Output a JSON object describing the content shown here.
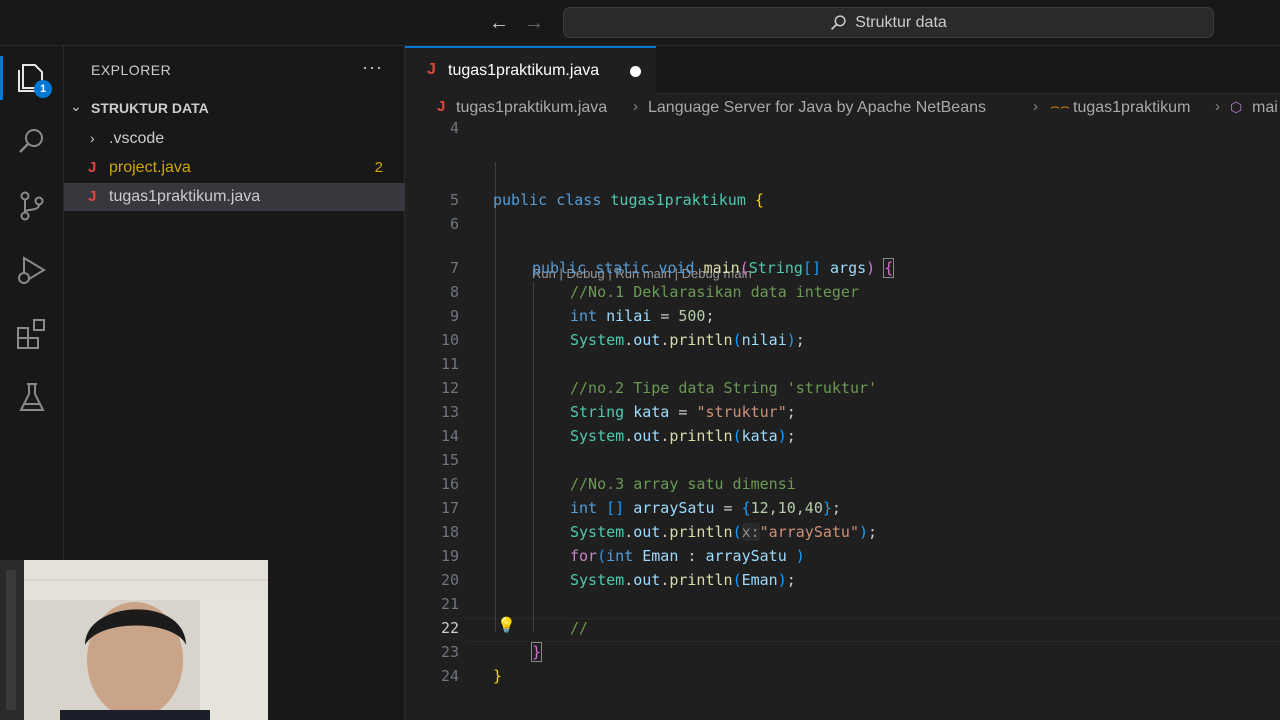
{
  "titlebar": {
    "search_text": "Struktur data"
  },
  "activitybar": {
    "explorer_badge": "1"
  },
  "sidebar": {
    "title": "EXPLORER",
    "more": "···",
    "folder_name": "STRUKTUR DATA",
    "items": [
      {
        "label": ".vscode",
        "icon": "chevron-right"
      },
      {
        "label": "project.java",
        "icon": "java-icon",
        "problems": "2"
      },
      {
        "label": "tugas1praktikum.java",
        "icon": "java-icon"
      }
    ]
  },
  "editor": {
    "tab_label": "tugas1praktikum.java",
    "breadcrumb": [
      "tugas1praktikum.java",
      "Language Server for Java by Apache NetBeans",
      "tugas1praktikum",
      "mai"
    ],
    "codelens": "Run | Debug | Run main | Debug main",
    "line_numbers": [
      "4",
      "5",
      "6",
      "7",
      "8",
      "9",
      "10",
      "11",
      "12",
      "13",
      "14",
      "15",
      "16",
      "17",
      "18",
      "19",
      "20",
      "21",
      "22",
      "23",
      "24"
    ],
    "active_line": "22",
    "lines": {
      "l5": [
        "public",
        "class",
        "tugas1praktikum",
        "{"
      ],
      "l7": [
        "public",
        "static",
        "void",
        "main",
        "(",
        "String",
        "[]",
        "args",
        ")",
        "{"
      ],
      "l8": "//No.1 Deklarasikan data integer",
      "l9": [
        "int",
        "nilai",
        "=",
        "500",
        ";"
      ],
      "l10": [
        "System",
        ".",
        "out",
        ".",
        "println",
        "(",
        "nilai",
        ")",
        ";"
      ],
      "l12": "//no.2 Tipe data String 'struktur'",
      "l13": [
        "String",
        "kata",
        "=",
        "\"struktur\"",
        ";"
      ],
      "l14": [
        "System",
        ".",
        "out",
        ".",
        "println",
        "(",
        "kata",
        ")",
        ";"
      ],
      "l16": "//No.3 array satu dimensi",
      "l17": [
        "int",
        "[]",
        "arraySatu",
        "=",
        "{",
        "12,10,40",
        "}",
        ";"
      ],
      "l18": [
        "System",
        ".",
        "out",
        ".",
        "println",
        "(",
        "x:",
        "\"arraySatu\"",
        ")",
        ";"
      ],
      "l19": [
        "for",
        "(",
        "int",
        "Eman",
        ":",
        "arraySatu",
        ")"
      ],
      "l20": [
        "System",
        ".",
        "out",
        ".",
        "println",
        "(",
        "Eman",
        ")",
        ";"
      ],
      "l22": "//",
      "l23": "}",
      "l24": "}"
    }
  },
  "colors": {
    "accent": "#0078d4",
    "java_icon": "#e0463d",
    "warning": "#cca700"
  }
}
